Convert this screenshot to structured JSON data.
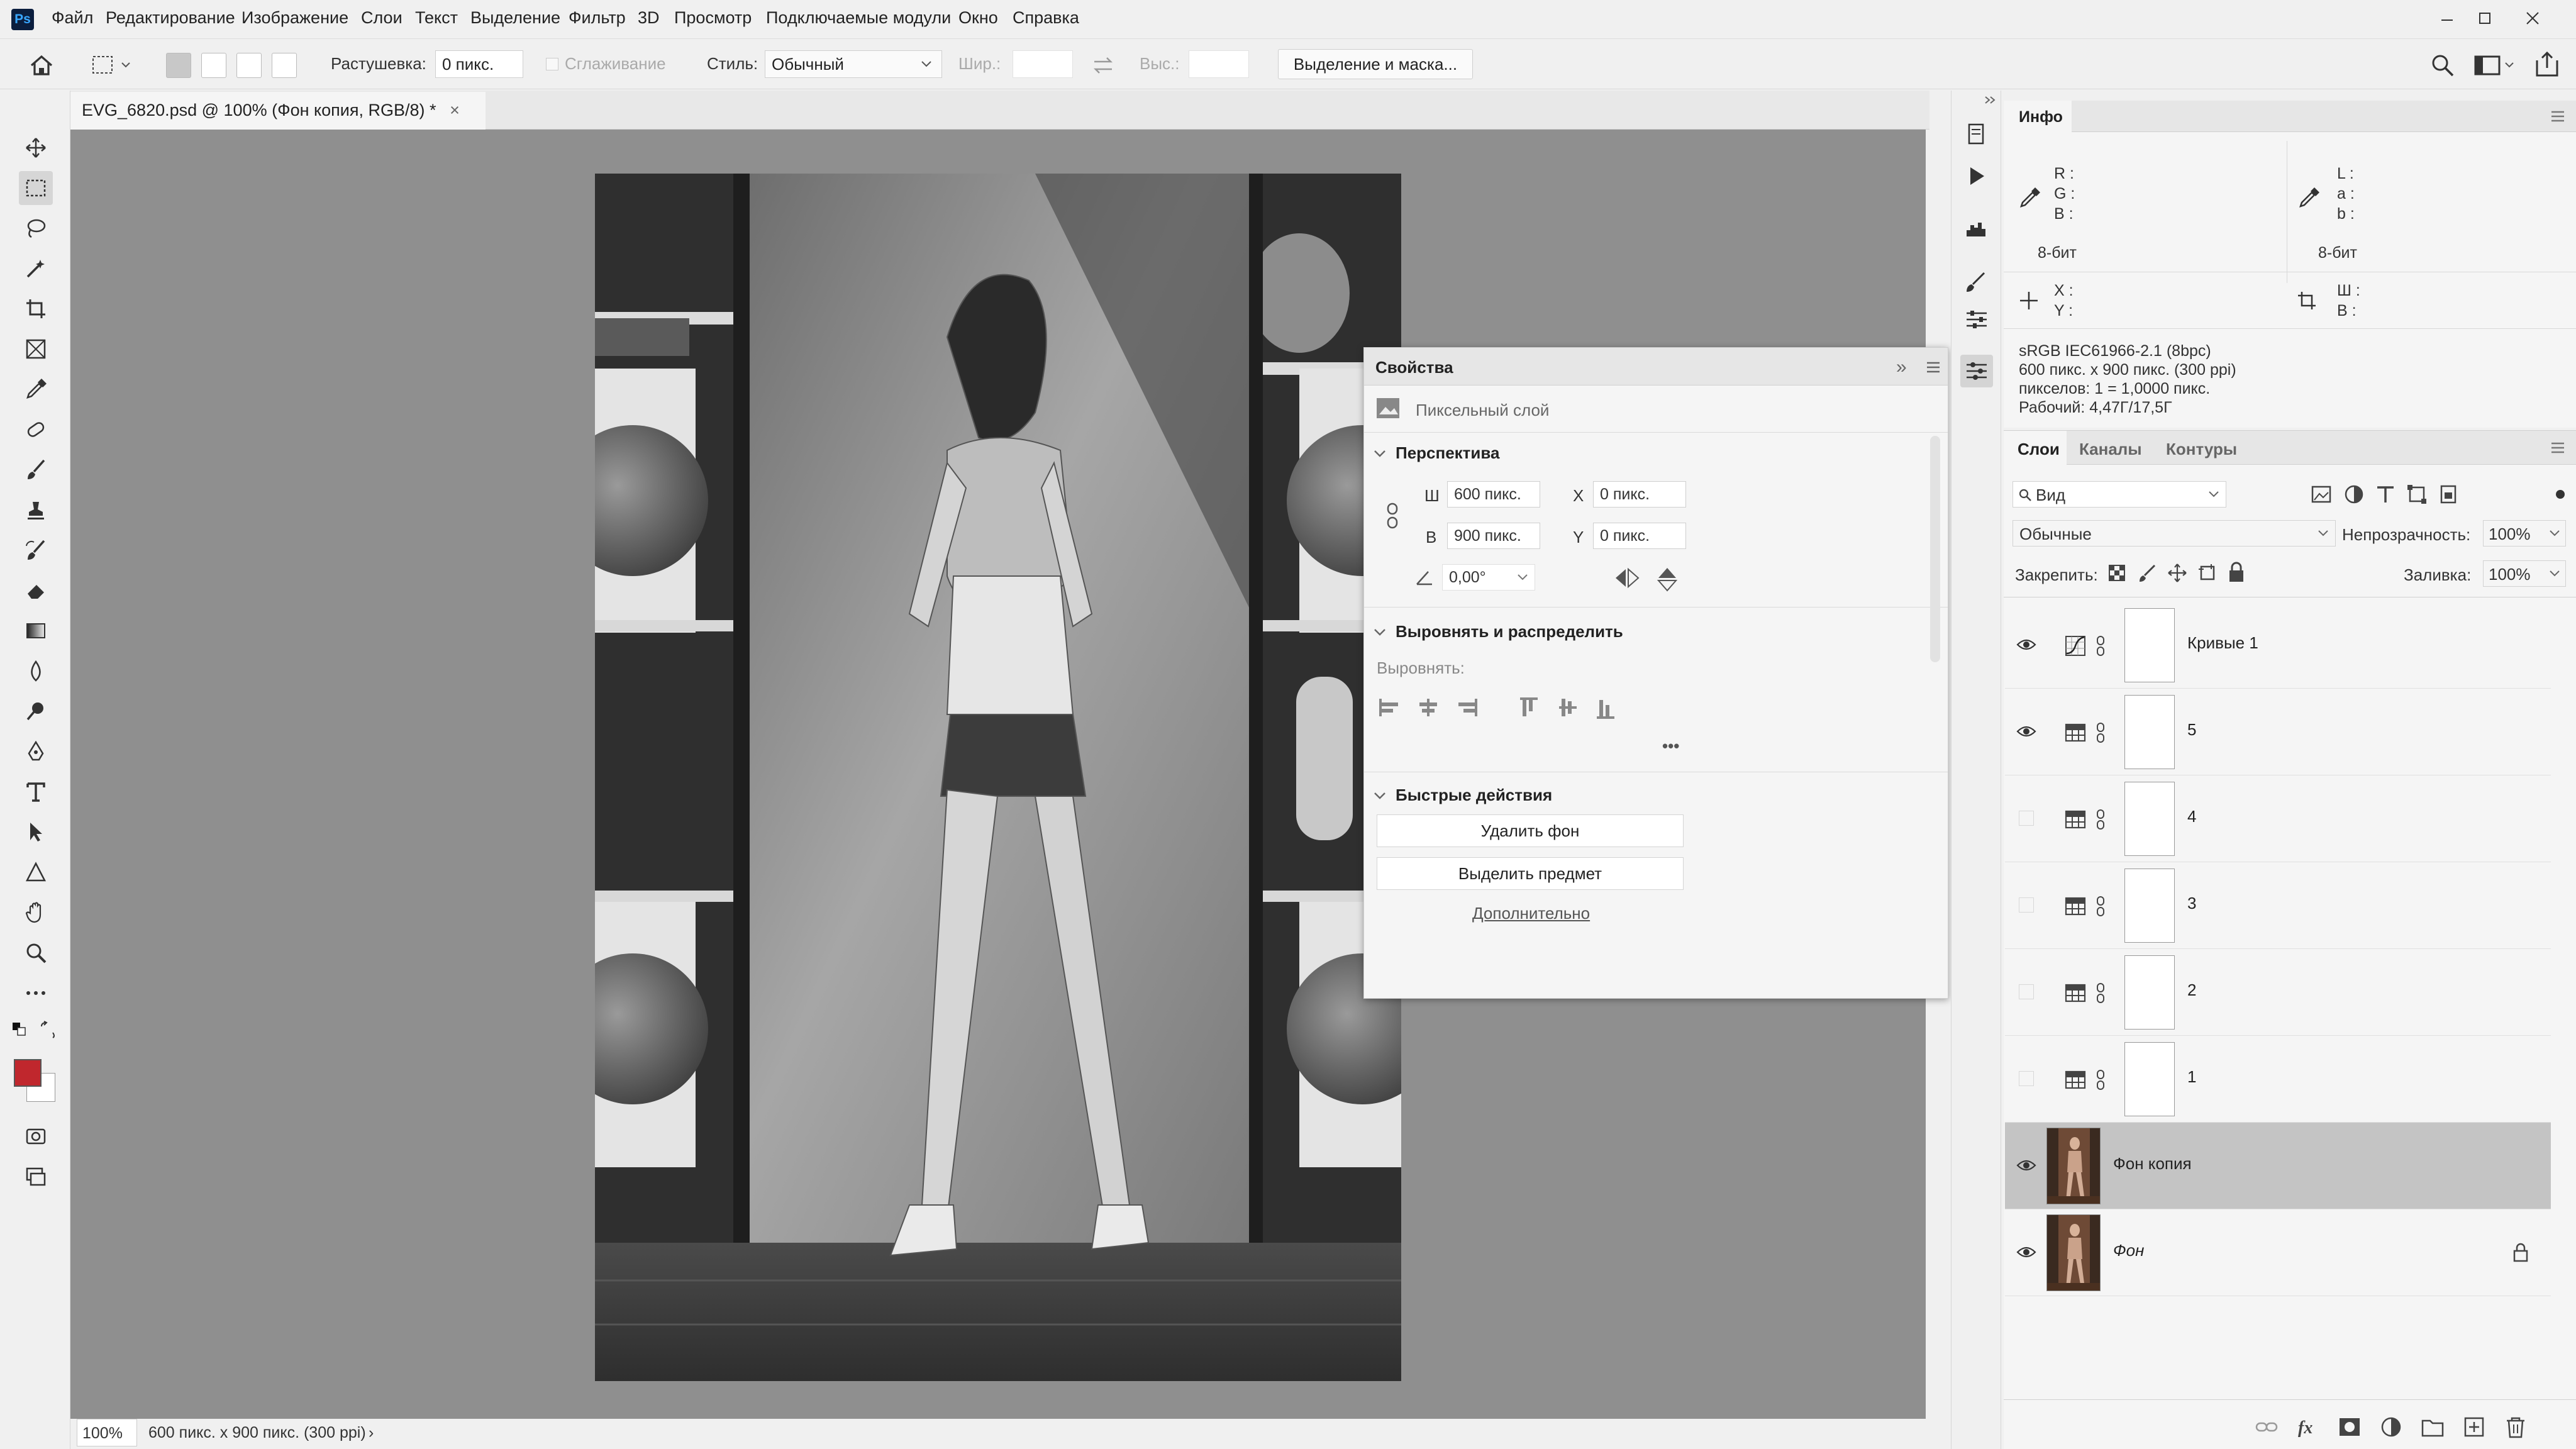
{
  "app": {
    "logo": "Ps",
    "menu": [
      "Файл",
      "Редактирование",
      "Изображение",
      "Слои",
      "Текст",
      "Выделение",
      "Фильтр",
      "3D",
      "Просмотр",
      "Подключаемые модули",
      "Окно",
      "Справка"
    ],
    "window_controls": [
      "minimize-icon",
      "restore-icon",
      "close-icon"
    ]
  },
  "options_bar": {
    "feather_label": "Растушевка:",
    "feather_value": "0 пикс.",
    "antialias_label": "Сглаживание",
    "style_label": "Стиль:",
    "style_value": "Обычный",
    "width_label": "Шир.:",
    "height_label": "Выс.:",
    "select_mask_button": "Выделение и маска..."
  },
  "document": {
    "tab_title": "EVG_6820.psd @ 100% (Фон копия, RGB/8) *",
    "tab_close": "×",
    "zoom": "100%",
    "doc_info": "600 пикс. x 900 пикс. (300 ppi)",
    "status_arrow": "›"
  },
  "properties": {
    "title": "Свойства",
    "collapse_icon": "»",
    "layer_type": "Пиксельный слой",
    "perspective": {
      "title": "Перспектива",
      "w_label": "Ш",
      "w_value": "600 пикс.",
      "h_label": "В",
      "h_value": "900 пикс.",
      "x_label": "X",
      "x_value": "0 пикс.",
      "y_label": "Y",
      "y_value": "0 пикс.",
      "angle_value": "0,00°"
    },
    "align": {
      "title": "Выровнять и распределить",
      "label": "Выровнять:",
      "more": "•••"
    },
    "quick_actions": {
      "title": "Быстрые действия",
      "remove_bg": "Удалить фон",
      "select_subject": "Выделить предмет",
      "more_link": "Дополнительно"
    }
  },
  "info": {
    "title": "Инфо",
    "rgb": [
      "R :",
      "G :",
      "B :"
    ],
    "lab": [
      "L :",
      "a :",
      "b :"
    ],
    "bit_depth_1": "8-бит",
    "bit_depth_2": "8-бит",
    "xy": [
      "X :",
      "Y :"
    ],
    "wh": [
      "Ш :",
      "В :"
    ],
    "doc_lines": [
      "sRGB IEC61966-2.1 (8bpc)",
      "600 пикс. x 900 пикс. (300 ppi)",
      "пикселов: 1 = 1,0000 пикс.",
      "Рабочий: 4,47Г/17,5Г"
    ]
  },
  "layers_panel": {
    "tabs": [
      "Слои",
      "Каналы",
      "Контуры"
    ],
    "filter_value": "Вид",
    "blend_mode": "Обычные",
    "opacity_label": "Непрозрачность:",
    "opacity_value": "100%",
    "lock_label": "Закрепить:",
    "fill_label": "Заливка:",
    "fill_value": "100%",
    "layers": [
      {
        "name": "Кривые 1",
        "visible": true,
        "type": "curves-icon",
        "selected": false
      },
      {
        "name": "5",
        "visible": true,
        "type": "table-icon",
        "selected": false
      },
      {
        "name": "4",
        "visible": false,
        "type": "table-icon",
        "selected": false
      },
      {
        "name": "3",
        "visible": false,
        "type": "table-icon",
        "selected": false
      },
      {
        "name": "2",
        "visible": false,
        "type": "table-icon",
        "selected": false
      },
      {
        "name": "1",
        "visible": false,
        "type": "table-icon",
        "selected": false
      },
      {
        "name": "Фон копия",
        "visible": true,
        "type": "photo",
        "selected": true
      },
      {
        "name": "Фон",
        "visible": true,
        "type": "photo",
        "selected": false,
        "locked": true
      }
    ]
  },
  "colors": {
    "foreground": "#c0272d",
    "background": "#ffffff",
    "canvas_bg": "#8f8f8f",
    "selected_layer": "#c4c4c4"
  }
}
